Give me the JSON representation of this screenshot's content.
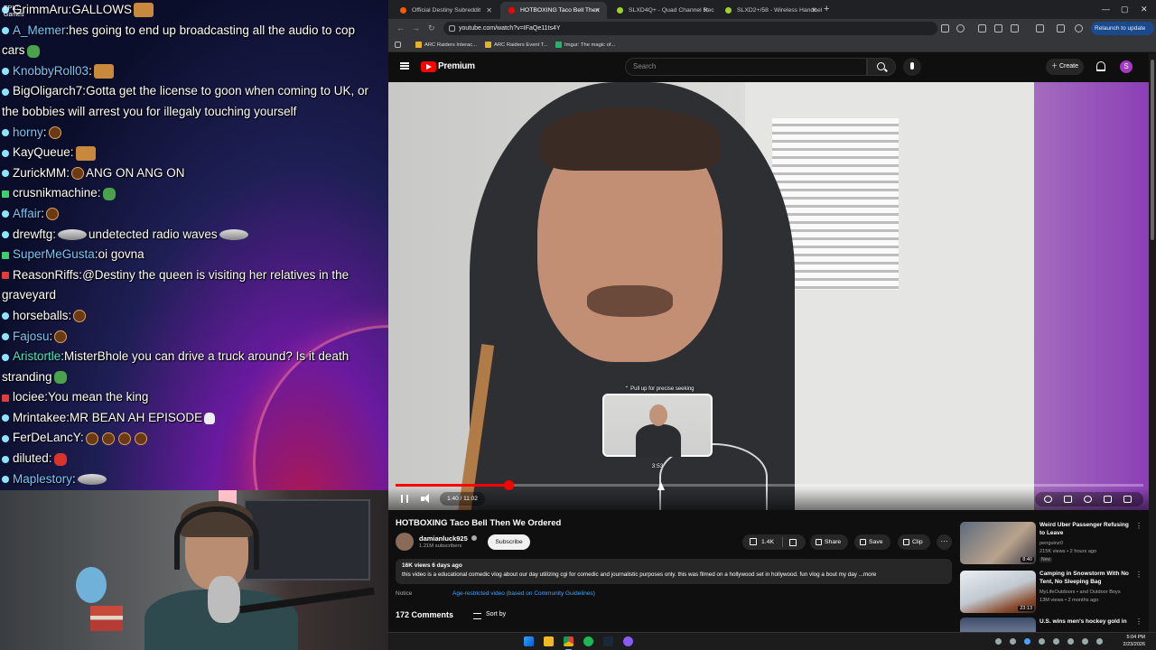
{
  "chat": {
    "epic_label": "EPIC\nGames",
    "lines": [
      {
        "user": "GrimmAru",
        "text": "GALLOWS"
      },
      {
        "user": "A_Memer",
        "text": "hes going to end up broadcasting all the audio to cop cars"
      },
      {
        "user": "KnobbyRoll03",
        "text": ""
      },
      {
        "user": "BigOligarch7",
        "text": "Gotta get the license to goon when coming to UK, or the bobbies will arrest you for illegaly touching yourself"
      },
      {
        "user": "horny",
        "text": ""
      },
      {
        "user": "KayQueue",
        "text": ""
      },
      {
        "user": "ZurickMM",
        "text": "ANG ON ANG ON"
      },
      {
        "user": "crusnikmachine",
        "text": ""
      },
      {
        "user": "Affair",
        "text": ""
      },
      {
        "user": "drewftg",
        "text": "undetected radio waves"
      },
      {
        "user": "SuperMeGusta",
        "text": "oi govna"
      },
      {
        "user": "ReasonRiffs",
        "text": "@Destiny the queen is visiting her relatives in the graveyard"
      },
      {
        "user": "horseballs",
        "text": ""
      },
      {
        "user": "Fajosu",
        "text": ""
      },
      {
        "user": "Aristortle",
        "text": "MisterBhole you can drive a truck around? Is it death stranding"
      },
      {
        "user": "lociee",
        "text": "You mean the king"
      },
      {
        "user": "Mrintakee",
        "text": "MR BEAN AH EPISODE"
      },
      {
        "user": "FerDeLancY",
        "text": ""
      },
      {
        "user": "diluted",
        "text": ""
      },
      {
        "user": "Maplestory",
        "text": ""
      }
    ]
  },
  "browser": {
    "tabs": [
      {
        "label": "Official Destiny Subreddit",
        "active": false
      },
      {
        "label": "HOTBOXING Taco Bell Then",
        "active": true
      },
      {
        "label": "SLXD4Q+ - Quad Channel Rec",
        "active": false
      },
      {
        "label": "SLXD2+/58 - Wireless Handhel",
        "active": false
      }
    ],
    "new_tab": "+",
    "url": "youtube.com/watch?v=IFaQe11ts4Y",
    "relaunch": "Relaunch to update",
    "bookmarks": [
      "ARC Raiders Interac...",
      "ARC Raiders Event T...",
      "Imgur: The magic of..."
    ]
  },
  "youtube": {
    "brand": "Premium",
    "search_placeholder": "Search",
    "create": "Create",
    "avatar_letter": "S",
    "player": {
      "seek_hint": "⌃ Pull up for precise seeking",
      "seek_time": "3:53",
      "time": "1:40 / 11:02",
      "progress_fraction": 0.151
    },
    "video": {
      "title": "HOTBOXING Taco Bell Then We Ordered",
      "channel": "damianluck925",
      "subscribers": "1.21M subscribers",
      "subscribe": "Subscribe",
      "likes": "1.4K",
      "share": "Share",
      "save": "Save",
      "clip": "Clip",
      "more": "···",
      "stats": "16K views  6 days ago",
      "description": "this video is a educational comedic vlog about our day utilizing cgi for comedic and journalistic  purposes only. this was filmed on a hollywood set in hollywood. fun vlog a bout my day ...more",
      "notice_label": "Notice",
      "notice_link": "Age-restricted video (based on Community Guidelines)",
      "comments": "172 Comments",
      "sort_by": "Sort by"
    },
    "recommendations": [
      {
        "title": "Weird Uber Passenger Refusing to Leave",
        "channel": "penguinz0",
        "meta": "215K views • 2 hours ago",
        "badge": "New",
        "duration": "8:40"
      },
      {
        "title": "Camping in Snowstorm With No Tent, No Sleeping Bag",
        "channel": "MyLifeOutdoors • and Outdoor Boys",
        "meta": "13M views • 2 months ago",
        "badge": "",
        "duration": "23:13"
      },
      {
        "title": "U.S. wins men's hockey gold in",
        "channel": "",
        "meta": "",
        "badge": "",
        "duration": ""
      }
    ]
  },
  "taskbar": {
    "time": "5:04 PM",
    "date": "2/23/2026"
  }
}
